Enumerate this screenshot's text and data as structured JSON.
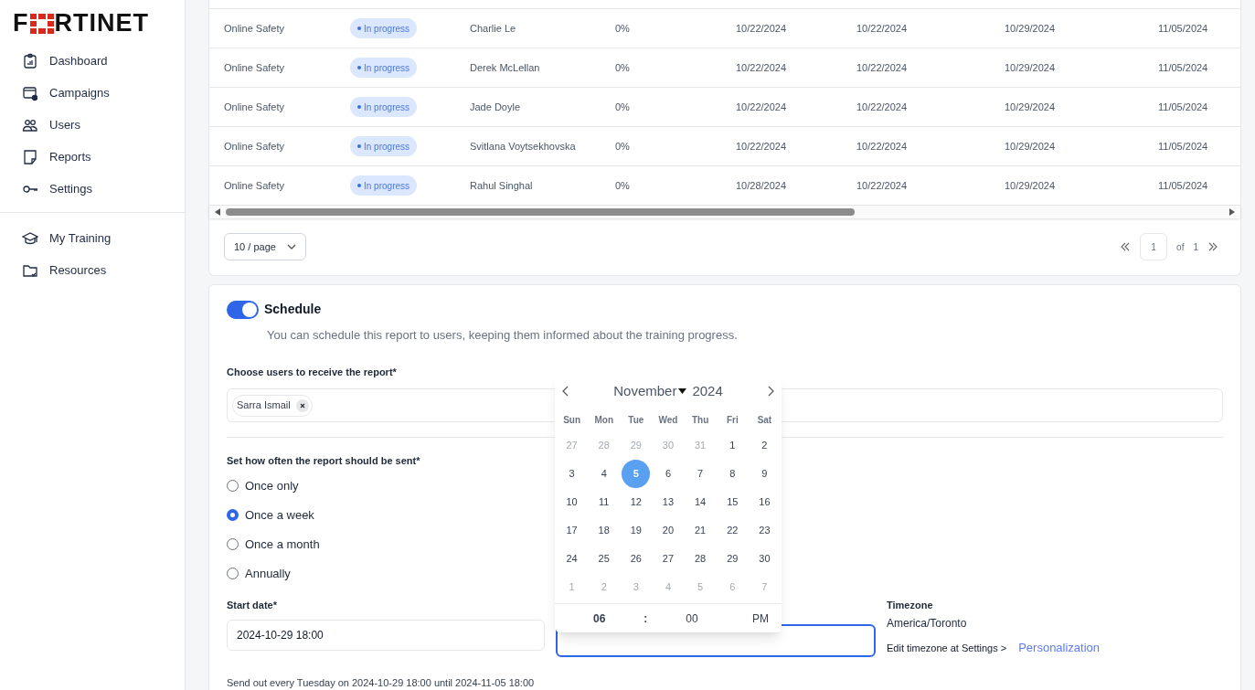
{
  "logo": {
    "before": "F",
    "after": "RTINET"
  },
  "sidebar": {
    "items": [
      {
        "label": "Dashboard",
        "kind": "dashboard",
        "selected": false
      },
      {
        "label": "Campaigns",
        "kind": "campaigns",
        "selected": false
      },
      {
        "label": "Users",
        "kind": "users",
        "selected": false
      },
      {
        "label": "Reports",
        "kind": "reports",
        "selected": false
      },
      {
        "label": "Settings",
        "kind": "settings",
        "selected": false
      }
    ],
    "items_2": [
      {
        "label": "My Training",
        "kind": "training",
        "selected": false
      },
      {
        "label": "Resources",
        "kind": "resources",
        "selected": false
      }
    ]
  },
  "table": {
    "rows": [
      {
        "cells": [
          "Online Safety",
          "In progress",
          "Charlie Le",
          "0%",
          "10/22/2024",
          "10/22/2024",
          "10/29/2024",
          "11/05/2024"
        ]
      },
      {
        "cells": [
          "Online Safety",
          "In progress",
          "Derek McLellan",
          "0%",
          "10/22/2024",
          "10/22/2024",
          "10/29/2024",
          "11/05/2024"
        ]
      },
      {
        "cells": [
          "Online Safety",
          "In progress",
          "Jade Doyle",
          "0%",
          "10/22/2024",
          "10/22/2024",
          "10/29/2024",
          "11/05/2024"
        ]
      },
      {
        "cells": [
          "Online Safety",
          "In progress",
          "Svitlana Voytsekhovska",
          "0%",
          "10/22/2024",
          "10/22/2024",
          "10/29/2024",
          "11/05/2024"
        ]
      },
      {
        "cells": [
          "Online Safety",
          "In progress",
          "Rahul Singhal",
          "0%",
          "10/28/2024",
          "10/22/2024",
          "10/29/2024",
          "11/05/2024"
        ]
      }
    ],
    "page_size": "10 / page",
    "page": "1",
    "of": "of",
    "total_pages": "1"
  },
  "schedule": {
    "on": true,
    "title": "Schedule",
    "description": "You can schedule this report to users, keeping them informed about the training progress.",
    "users_label": "Choose users to receive the report*",
    "users": [
      "Sarra Ismail"
    ],
    "frequency_label": "Set how often the report should be sent*",
    "options": [
      {
        "label": "Once only",
        "selected": false
      },
      {
        "label": "Once a week",
        "selected": true
      },
      {
        "label": "Once a month",
        "selected": false
      },
      {
        "label": "Annually",
        "selected": false
      }
    ],
    "start_label": "Start date*",
    "start_value": "2024-10-29 18:00",
    "timezone_label": "Timezone",
    "timezone": "America/Toronto",
    "edit_timezone": "Edit timezone at Settings >",
    "edit_link": "Personalization",
    "summary": "Send out every Tuesday on 2024-10-29 18:00 until 2024-11-05 18:00"
  },
  "calendar": {
    "month": "November",
    "year": "2024",
    "weekdays": [
      "Sun",
      "Mon",
      "Tue",
      "Wed",
      "Thu",
      "Fri",
      "Sat"
    ],
    "days": [
      {
        "d": "27",
        "outside": true,
        "selected": false
      },
      {
        "d": "28",
        "outside": true,
        "selected": false
      },
      {
        "d": "29",
        "outside": true,
        "selected": false
      },
      {
        "d": "30",
        "outside": true,
        "selected": false
      },
      {
        "d": "31",
        "outside": true,
        "selected": false
      },
      {
        "d": "1",
        "outside": false,
        "selected": false
      },
      {
        "d": "2",
        "outside": false,
        "selected": false
      },
      {
        "d": "3",
        "outside": false,
        "selected": false
      },
      {
        "d": "4",
        "outside": false,
        "selected": false
      },
      {
        "d": "5",
        "outside": false,
        "selected": true
      },
      {
        "d": "6",
        "outside": false,
        "selected": false
      },
      {
        "d": "7",
        "outside": false,
        "selected": false
      },
      {
        "d": "8",
        "outside": false,
        "selected": false
      },
      {
        "d": "9",
        "outside": false,
        "selected": false
      },
      {
        "d": "10",
        "outside": false,
        "selected": false
      },
      {
        "d": "11",
        "outside": false,
        "selected": false
      },
      {
        "d": "12",
        "outside": false,
        "selected": false
      },
      {
        "d": "13",
        "outside": false,
        "selected": false
      },
      {
        "d": "14",
        "outside": false,
        "selected": false
      },
      {
        "d": "15",
        "outside": false,
        "selected": false
      },
      {
        "d": "16",
        "outside": false,
        "selected": false
      },
      {
        "d": "17",
        "outside": false,
        "selected": false
      },
      {
        "d": "18",
        "outside": false,
        "selected": false
      },
      {
        "d": "19",
        "outside": false,
        "selected": false
      },
      {
        "d": "20",
        "outside": false,
        "selected": false
      },
      {
        "d": "21",
        "outside": false,
        "selected": false
      },
      {
        "d": "22",
        "outside": false,
        "selected": false
      },
      {
        "d": "23",
        "outside": false,
        "selected": false
      },
      {
        "d": "24",
        "outside": false,
        "selected": false
      },
      {
        "d": "25",
        "outside": false,
        "selected": false
      },
      {
        "d": "26",
        "outside": false,
        "selected": false
      },
      {
        "d": "27",
        "outside": false,
        "selected": false
      },
      {
        "d": "28",
        "outside": false,
        "selected": false
      },
      {
        "d": "29",
        "outside": false,
        "selected": false
      },
      {
        "d": "30",
        "outside": false,
        "selected": false
      },
      {
        "d": "1",
        "outside": true,
        "selected": false
      },
      {
        "d": "2",
        "outside": true,
        "selected": false
      },
      {
        "d": "3",
        "outside": true,
        "selected": false
      },
      {
        "d": "4",
        "outside": true,
        "selected": false
      },
      {
        "d": "5",
        "outside": true,
        "selected": false
      },
      {
        "d": "6",
        "outside": true,
        "selected": false
      },
      {
        "d": "7",
        "outside": true,
        "selected": false
      }
    ],
    "hour": "06",
    "separator": ":",
    "minute": "00",
    "ampm": "PM"
  }
}
